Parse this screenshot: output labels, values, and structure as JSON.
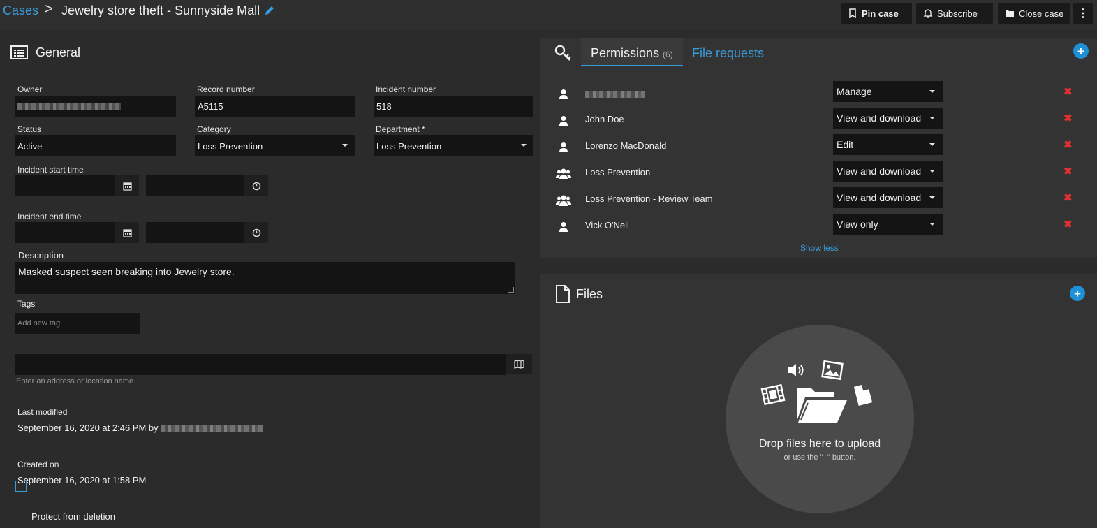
{
  "header": {
    "breadcrumb_link": "Cases",
    "breadcrumb_sep": ">",
    "title": "Jewelry store theft - Sunnyside Mall",
    "pin_label": "Pin case",
    "subscribe_label": "Subscribe",
    "close_label": "Close case",
    "more_label": "⋮"
  },
  "general": {
    "title": "General",
    "owner_label": "Owner",
    "record_label": "Record number",
    "record_value": "A5115",
    "incident_label": "Incident number",
    "incident_value": "518",
    "status_label": "Status",
    "status_value": "Active",
    "category_label": "Category",
    "category_value": "Loss Prevention",
    "department_label": "Department *",
    "department_value": "Loss Prevention",
    "start_label": "Incident start time",
    "end_label": "Incident end time",
    "description_label": "Description",
    "description_value": "Masked suspect seen breaking into Jewelry store.",
    "tags_label": "Tags",
    "tags_placeholder": "Add new tag",
    "location_hint": "Enter an address or location name",
    "last_modified_label": "Last modified",
    "last_modified_value": "September 16, 2020 at 2:46 PM by",
    "created_label": "Created on",
    "created_value": "September 16, 2020 at 1:58 PM",
    "protect_label": "Protect from deletion"
  },
  "permissions": {
    "tab_label": "Permissions",
    "count": "(6)",
    "file_requests_tab": "File requests",
    "show_less": "Show less",
    "rows": [
      {
        "name": "",
        "type": "user",
        "permission": "Manage"
      },
      {
        "name": "John Doe",
        "type": "user",
        "permission": "View and download"
      },
      {
        "name": "Lorenzo MacDonald",
        "type": "user",
        "permission": "Edit"
      },
      {
        "name": "Loss Prevention",
        "type": "group",
        "permission": "View and download"
      },
      {
        "name": "Loss Prevention - Review Team",
        "type": "group",
        "permission": "View and download"
      },
      {
        "name": "Vick O'Neil",
        "type": "user",
        "permission": "View only"
      }
    ]
  },
  "files": {
    "title": "Files",
    "drop_main": "Drop files here to upload",
    "drop_sub": "or use the \"+\" button."
  },
  "colors": {
    "accent": "#3a9bd9",
    "delete": "#e03030",
    "add_button": "#1f8fd6"
  }
}
